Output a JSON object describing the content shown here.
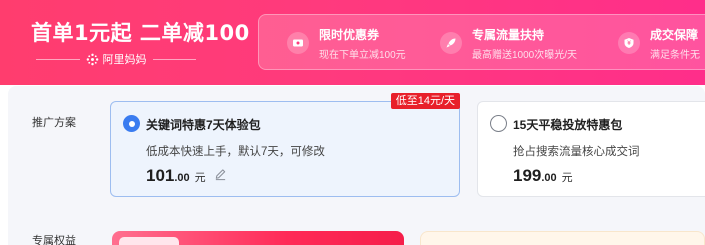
{
  "banner": {
    "title": "首单1元起 二单减100",
    "brand": "阿里妈妈",
    "benefits": [
      {
        "icon": "coupon-icon",
        "title": "限时优惠券",
        "desc": "现在下单立减100元"
      },
      {
        "icon": "rocket-icon",
        "title": "专属流量扶持",
        "desc": "最高赠送1000次曝光/天"
      },
      {
        "icon": "shield-icon",
        "title": "成交保障",
        "desc": "满足条件无"
      }
    ]
  },
  "promo": {
    "label": "推广方案",
    "plans": [
      {
        "name": "关键词特惠7天体验包",
        "desc": "低成本快速上手，默认7天，可修改",
        "price_int": "101",
        "price_dec": ".00",
        "unit": "元",
        "tag": "低至14元/天",
        "selected": true
      },
      {
        "name": "15天平稳投放特惠包",
        "desc": "抢占搜索流量核心成交词",
        "price_int": "199",
        "price_dec": ".00",
        "unit": "元",
        "selected": false
      }
    ]
  },
  "rights": {
    "label": "专属权益"
  },
  "colors": {
    "banner": "#ff3a7d",
    "accent_blue": "#3a7cf0",
    "tag_red": "#e8202a"
  }
}
